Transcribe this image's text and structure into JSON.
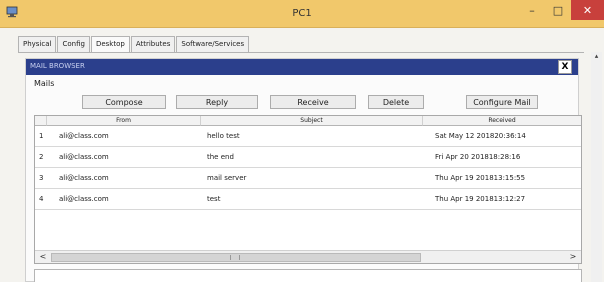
{
  "window": {
    "title": "PC1",
    "min_glyph": "–",
    "max_glyph": "□",
    "close_glyph": "✕",
    "icon": "packet-tracer-pc-icon"
  },
  "tabs": [
    {
      "label": "Physical"
    },
    {
      "label": "Config"
    },
    {
      "label": "Desktop"
    },
    {
      "label": "Attributes"
    },
    {
      "label": "Software/Services"
    }
  ],
  "active_tab": "Desktop",
  "mail_browser": {
    "title": "MAIL BROWSER",
    "close_label": "X",
    "mails_label": "Mails",
    "buttons": {
      "compose": "Compose",
      "reply": "Reply",
      "receive": "Receive",
      "delete": "Delete",
      "configure": "Configure Mail"
    },
    "columns": {
      "from": "From",
      "subject": "Subject",
      "received": "Received"
    },
    "rows": [
      {
        "index": "1",
        "from": "ali@class.com",
        "subject": "hello test",
        "received": "Sat May 12 201820:36:14"
      },
      {
        "index": "2",
        "from": "ali@class.com",
        "subject": "the end",
        "received": "Fri Apr 20 201818:28:16"
      },
      {
        "index": "3",
        "from": "ali@class.com",
        "subject": "mail server",
        "received": "Thu Apr 19 201813:15:55"
      },
      {
        "index": "4",
        "from": "ali@class.com",
        "subject": "test",
        "received": "Thu Apr 19 201813:12:27"
      }
    ],
    "scroll_left": "<",
    "scroll_right": ">"
  },
  "colors": {
    "titlebar": "#f1c86b",
    "header_bar": "#2b3f8c",
    "close_red": "#c8403c"
  }
}
